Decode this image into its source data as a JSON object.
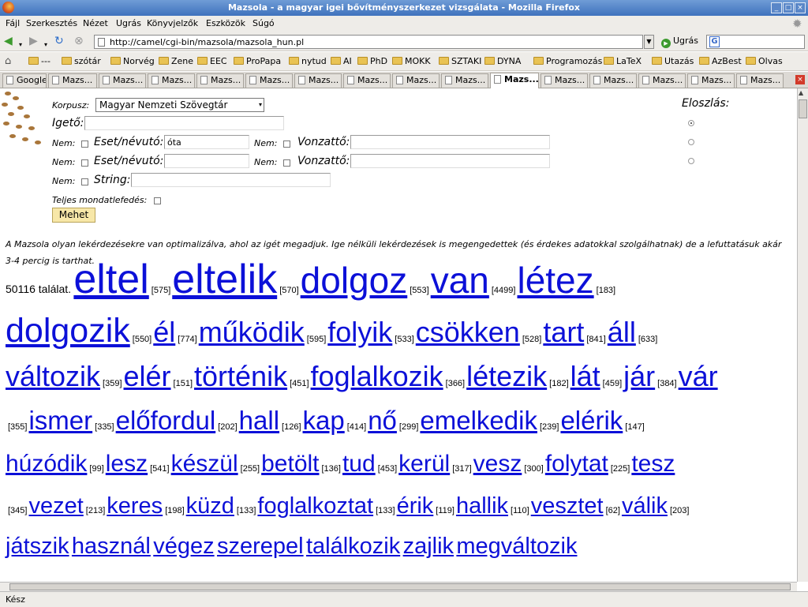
{
  "window": {
    "title": "Mazsola - a magyar igei bővítményszerkezet vizsgálata - Mozilla Firefox"
  },
  "menu": [
    "Fájl",
    "Szerkesztés",
    "Nézet",
    "Ugrás",
    "Könyvjelzők",
    "Eszközök",
    "Súgó"
  ],
  "nav": {
    "url": "http://camel/cgi-bin/mazsola/mazsola_hun.pl",
    "go_label": "Ugrás",
    "search_placeholder": ""
  },
  "bookmarks": [
    "---",
    "szótár",
    "Norvég",
    "Zene",
    "EEC",
    "ProPapa",
    "nytud",
    "AI",
    "PhD",
    "MOKK",
    "SZTAKI",
    "DYNA",
    "Programozás",
    "LaTeX",
    "Utazás",
    "AzBest",
    "Olvas"
  ],
  "tabs": [
    "Google",
    "Mazs...",
    "Mazs...",
    "Mazs...",
    "Mazs...",
    "Mazs...",
    "Mazs...",
    "Mazs...",
    "Mazs...",
    "Mazs...",
    "Mazs...",
    "Mazs...",
    "Mazs...",
    "Mazs...",
    "Mazs...",
    "Mazs..."
  ],
  "active_tab": 10,
  "form": {
    "corpus_label": "Korpusz:",
    "corpus_value": "Magyar Nemzeti Szövegtár",
    "distribution_label": "Eloszlás:",
    "verb_label": "Igető:",
    "verb_value": "",
    "not_label": "Nem:",
    "case_label": "Eset/névutó:",
    "complement_label": "Vonzattő:",
    "case1_value": "óta",
    "case2_value": "",
    "comp1_value": "",
    "comp2_value": "",
    "string_label": "String:",
    "string_value": "",
    "full_sentence_label": "Teljes mondatlefedés:",
    "submit_label": "Mehet",
    "distribution_selected": 0
  },
  "info_text": "A Mazsola olyan lekérdezésekre van optimalizálva, ahol az igét megadjuk. Ige nélküli lekérdezések is megengedettek (és érdekes adatokkal szolgálhatnak) de a lefuttatásuk akár 3-4 percig is tarthat.",
  "results": {
    "hits_text": "50116 találat.",
    "lines": [
      [
        {
          "w": "eltel",
          "n": "[575]"
        },
        {
          "w": "eltelik",
          "n": "[570]"
        },
        {
          "w": "dolgoz",
          "n": "[553]"
        },
        {
          "w": "van",
          "n": "[4499]"
        },
        {
          "w": "létez",
          "n": "[183]"
        }
      ],
      [
        {
          "w": "dolgozik",
          "n": "[550]"
        },
        {
          "w": "él",
          "n": "[774]"
        },
        {
          "w": "működik",
          "n": "[595]"
        },
        {
          "w": "folyik",
          "n": "[533]"
        },
        {
          "w": "csökken",
          "n": "[528]"
        },
        {
          "w": "tart",
          "n": "[841]"
        },
        {
          "w": "áll",
          "n": "[633]"
        }
      ],
      [
        {
          "w": "változik",
          "n": "[359]"
        },
        {
          "w": "elér",
          "n": "[151]"
        },
        {
          "w": "történik",
          "n": "[451]"
        },
        {
          "w": "foglalkozik",
          "n": "[366]"
        },
        {
          "w": "létezik",
          "n": "[182]"
        },
        {
          "w": "lát",
          "n": "[459]"
        },
        {
          "w": "jár",
          "n": "[384]"
        },
        {
          "w": "vár",
          "n": ""
        }
      ],
      [
        {
          "w": "",
          "n": "[355]"
        },
        {
          "w": "ismer",
          "n": "[335]"
        },
        {
          "w": "előfordul",
          "n": "[202]"
        },
        {
          "w": "hall",
          "n": "[126]"
        },
        {
          "w": "kap",
          "n": "[414]"
        },
        {
          "w": "nő",
          "n": "[299]"
        },
        {
          "w": "emelkedik",
          "n": "[239]"
        },
        {
          "w": "elérik",
          "n": "[147]"
        }
      ],
      [
        {
          "w": "húzódik",
          "n": "[99]"
        },
        {
          "w": "lesz",
          "n": "[541]"
        },
        {
          "w": "készül",
          "n": "[255]"
        },
        {
          "w": "betölt",
          "n": "[136]"
        },
        {
          "w": "tud",
          "n": "[453]"
        },
        {
          "w": "kerül",
          "n": "[317]"
        },
        {
          "w": "vesz",
          "n": "[300]"
        },
        {
          "w": "folytat",
          "n": "[225]"
        },
        {
          "w": "tesz",
          "n": ""
        }
      ],
      [
        {
          "w": "",
          "n": "[345]"
        },
        {
          "w": "vezet",
          "n": "[213]"
        },
        {
          "w": "keres",
          "n": "[198]"
        },
        {
          "w": "küzd",
          "n": "[133]"
        },
        {
          "w": "foglalkoztat",
          "n": "[133]"
        },
        {
          "w": "érik",
          "n": "[119]"
        },
        {
          "w": "hallik",
          "n": "[110]"
        },
        {
          "w": "vesztet",
          "n": "[62]"
        },
        {
          "w": "válik",
          "n": "[203]"
        }
      ],
      [
        {
          "w": "játszik",
          "n": ""
        },
        {
          "w": "használ",
          "n": ""
        },
        {
          "w": "végez",
          "n": ""
        },
        {
          "w": "szerepel",
          "n": ""
        },
        {
          "w": "találkozik",
          "n": ""
        },
        {
          "w": "zajlik",
          "n": ""
        },
        {
          "w": "megváltozik",
          "n": ""
        }
      ]
    ]
  },
  "status": "Kész"
}
